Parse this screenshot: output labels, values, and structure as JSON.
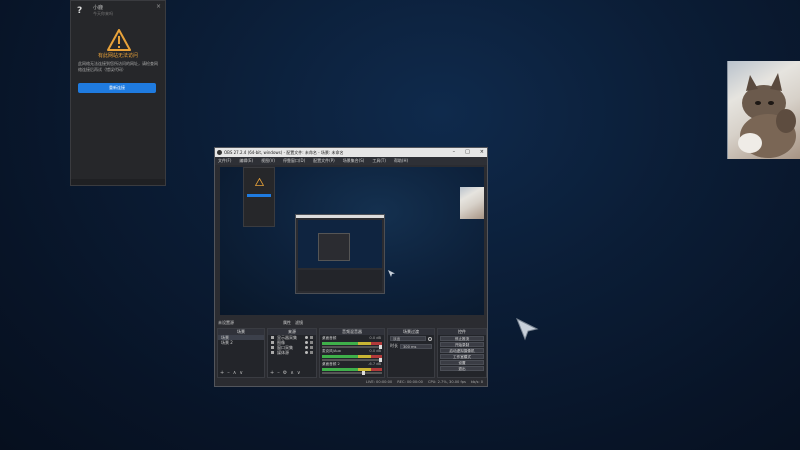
{
  "help_popup": {
    "title": "?",
    "name": "小鹿",
    "subtitle": "今天你来吗",
    "close": "×",
    "heading": "有此网站无法访问",
    "text": "此网络无法连接到您所访问的网址，请检查网络连接后再试（错误代码）",
    "button_label": "重新连接"
  },
  "obs": {
    "title": "OBS 27.2.4 (64-bit, windows) - 配置文件: 未命名 - 场景: 未命名",
    "window_buttons": [
      "–",
      "□",
      "×"
    ],
    "menu": [
      "文件(F)",
      "编辑(E)",
      "视图(V)",
      "停靠窗口(D)",
      "配置文件(P)",
      "场景集合(S)",
      "工具(T)",
      "帮助(H)"
    ],
    "scene_bar": {
      "label": "未设置源",
      "buttons": [
        "属性",
        "滤镜"
      ]
    },
    "docks": {
      "scenes": {
        "title": "场景",
        "items": [
          "场景",
          "场景 2"
        ],
        "toolbar": [
          "+",
          "–",
          "∧",
          "∨"
        ]
      },
      "sources": {
        "title": "来源",
        "items": [
          "显示器采集",
          "图像",
          "窗口采集",
          "媒体源"
        ],
        "toolbar": [
          "+",
          "–",
          "⚙",
          "∧",
          "∨"
        ]
      },
      "mixer": {
        "title": "音频混音器",
        "channels": [
          {
            "name": "桌面音频",
            "db": "0.0 dB",
            "volume": 1.0
          },
          {
            "name": "麦克风/Aux",
            "db": "0.0 dB",
            "volume": 1.0
          },
          {
            "name": "桌面音频 2",
            "db": "-6.7 dB",
            "volume": 0.7
          }
        ]
      },
      "transitions": {
        "title": "场景过渡",
        "type": "淡出",
        "duration_label": "时长",
        "duration": "300 ms"
      },
      "controls": {
        "title": "控件",
        "buttons": [
          "停止推流",
          "开始录制",
          "启动虚拟摄像机",
          "工作室模式",
          "设置",
          "退出"
        ]
      }
    },
    "status": {
      "live": "LIVE: 00:00:00",
      "rec": "REC: 00:00:00",
      "cpu": "CPU: 2.7%, 30.00 fps",
      "kbps": "kb/s: 0"
    }
  }
}
